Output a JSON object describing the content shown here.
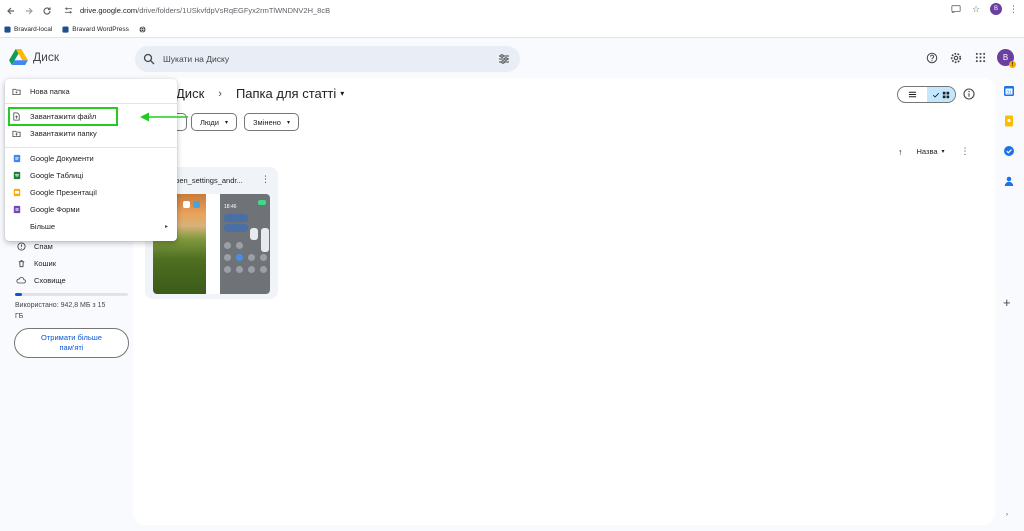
{
  "browser": {
    "url_main": "drive.google.com",
    "url_path": "/drive/folders/1USkvfdpVsRqEGFyx2rmTlWNDNV2H_8cB",
    "profile_initial": "B",
    "bookmarks": [
      {
        "label": "Bravard-local"
      },
      {
        "label": "Bravard WordPress"
      }
    ]
  },
  "header": {
    "app_name": "Диск",
    "search_placeholder": "Шукати на Диску",
    "avatar_initial": "B",
    "avatar_badge": "!"
  },
  "breadcrumb": {
    "root": "Диск",
    "separator": "›",
    "current": "Папка для статті",
    "caret": "▾"
  },
  "filters": [
    {
      "label": "Люди",
      "caret": "▾"
    },
    {
      "label": "Змінено",
      "caret": "▾"
    }
  ],
  "sort": {
    "arrow": "↑",
    "label": "Назва",
    "caret": "▾",
    "kebab": "⋮"
  },
  "file_card": {
    "name": "open_settings_andr...",
    "kebab": "⋮",
    "phone2_time": "18:46"
  },
  "new_menu": {
    "items": [
      {
        "label": "Нова папка",
        "icon": "folder-plus-icon"
      },
      {
        "label": "Завантажити файл",
        "icon": "file-upload-icon"
      },
      {
        "label": "Завантажити папку",
        "icon": "folder-upload-icon"
      },
      {
        "label": "Google Документи",
        "icon": "docs-icon"
      },
      {
        "label": "Google Таблиці",
        "icon": "sheets-icon"
      },
      {
        "label": "Google Презентації",
        "icon": "slides-icon"
      },
      {
        "label": "Google Форми",
        "icon": "forms-icon"
      },
      {
        "label": "Більше",
        "icon": "",
        "submenu": "▸"
      }
    ]
  },
  "sidebar": {
    "items": [
      {
        "label": "Спам",
        "icon": "spam-icon"
      },
      {
        "label": "Кошик",
        "icon": "trash-icon"
      },
      {
        "label": "Сховище",
        "icon": "cloud-icon"
      }
    ],
    "storage_text": "Використано: 942,8 МБ з 15 ГБ",
    "storage_used_fraction": 0.06,
    "get_more_button": "Отримати більше пам'яті"
  },
  "colors": {
    "accent": "#0b57d0",
    "annotation_green": "#22cc22",
    "docs": "#4285f4",
    "sheets": "#188038",
    "slides": "#f9ab00",
    "forms": "#7248b9"
  }
}
